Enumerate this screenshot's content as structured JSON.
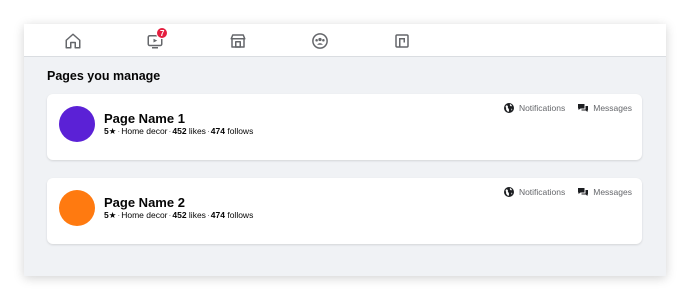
{
  "nav": {
    "items": [
      {
        "icon": "home-icon"
      },
      {
        "icon": "watch-icon",
        "badge": "7"
      },
      {
        "icon": "marketplace-icon"
      },
      {
        "icon": "groups-icon"
      },
      {
        "icon": "gaming-icon"
      }
    ]
  },
  "main": {
    "section_title": "Pages you manage",
    "pages": [
      {
        "name": "Page Name 1",
        "avatar_color": "#5b21d6",
        "rating": "5★",
        "category": "Home decor",
        "likes_count": "452",
        "likes_label": "likes",
        "follows_count": "474",
        "follows_label": "follows",
        "notifications_label": "Notifications",
        "messages_label": "Messages"
      },
      {
        "name": "Page Name 2",
        "avatar_color": "#ff7a10",
        "rating": "5★",
        "category": "Home decor",
        "likes_count": "452",
        "likes_label": "likes",
        "follows_count": "474",
        "follows_label": "follows",
        "notifications_label": "Notifications",
        "messages_label": "Messages"
      }
    ]
  }
}
